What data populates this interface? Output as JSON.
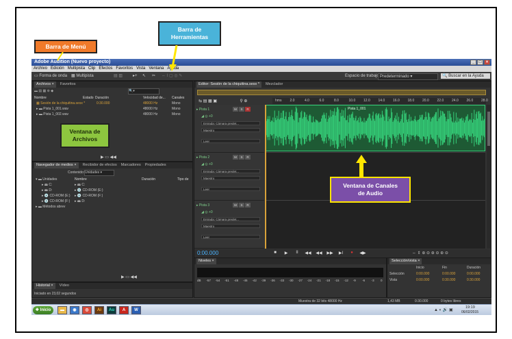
{
  "window": {
    "title": "Adobe Audition (Nuevo proyecto)"
  },
  "menubar": {
    "items": [
      "Archivo",
      "Edición",
      "Multipista",
      "Clip",
      "Efectos",
      "Favoritos",
      "Vista",
      "Ventana",
      "Ayuda"
    ]
  },
  "toolbar": {
    "mode_waveform": "Forma de onda",
    "mode_multitrack": "Multipista",
    "workspace_label": "Espacio de trabajo:",
    "workspace_value": "Predeterminado",
    "help_search": "Buscar en la Ayuda"
  },
  "files_panel": {
    "tabs": [
      "Archivos ×",
      "Favoritos"
    ],
    "columns": [
      "Nombre",
      "Estado",
      "Duración",
      "Velocidad de...",
      "Canales"
    ],
    "rows": [
      {
        "name": "Sesión de la chiquitina.sesx *",
        "duration": "0:30.000",
        "rate": "48000 Hz",
        "channels": "Mono"
      },
      {
        "name": "Pista 1_001.wav",
        "duration": "",
        "rate": "48000 Hz",
        "channels": "Mono"
      },
      {
        "name": "Pista 1_002.wav",
        "duration": "",
        "rate": "48000 Hz",
        "channels": "Mono"
      }
    ]
  },
  "media_panel": {
    "tabs": [
      "Navegador de medios ×",
      "Recibidor de efectos",
      "Marcadores",
      "Propiedades"
    ],
    "content_label": "Contenido:",
    "content_value": "Unidades",
    "left_header": "Unidades",
    "right_columns": [
      "Nombre",
      "Duración",
      "Tipo de"
    ],
    "drives": [
      "C:",
      "D:",
      "CD-ROM (E:)",
      "CD-ROM (F:)"
    ],
    "favorites": "Métodos abrev",
    "right_items": [
      "C:",
      "CD-ROM (E:)",
      "CD-ROM (F:)",
      "D:"
    ]
  },
  "history_panel": {
    "tabs": [
      "Historial ×",
      "Vídeo"
    ],
    "status": "Iniciado en 23,02 segundos"
  },
  "editor": {
    "tabs": [
      "Editor: Sesión de la chiquitina.sesx *",
      "Mezclador"
    ],
    "ruler": [
      "hms",
      "2.0",
      "4.0",
      "6.0",
      "8.0",
      "10.0",
      "12.0",
      "14.0",
      "16.0",
      "18.0",
      "20.0",
      "22.0",
      "24.0",
      "26.0",
      "28.0"
    ],
    "timecode": "0:00.000",
    "tracks": [
      {
        "name": "Pista 1",
        "input": "Entrada: Cámara predet...",
        "output": "Maestro",
        "mode": "Leer",
        "volume": "+0"
      },
      {
        "name": "Pista 2",
        "input": "Entrada: Cámara predet...",
        "output": "Maestro",
        "mode": "Leer",
        "volume": "+0"
      },
      {
        "name": "Pista 3",
        "input": "Entrada: Cámara predet...",
        "output": "Maestro",
        "mode": "Leer",
        "volume": "+0"
      }
    ],
    "clip_label": "Pista 1_001",
    "transport": [
      "■",
      "▶",
      "II",
      "◀◀",
      "◀◀",
      "▶▶",
      "▶I",
      "●",
      "◀▶"
    ]
  },
  "levels_panel": {
    "tab": "Niveles ×",
    "scale": [
      "dB",
      "-57",
      "-54",
      "-51",
      "-48",
      "-45",
      "-42",
      "-39",
      "-36",
      "-33",
      "-30",
      "-27",
      "-24",
      "-21",
      "-18",
      "-15",
      "-12",
      "-9",
      "-6",
      "-3",
      "0"
    ]
  },
  "selection_panel": {
    "tab": "Selección/vista ×",
    "headers": [
      "Inicio",
      "Fin",
      "Duración"
    ],
    "rows": [
      {
        "label": "Selección",
        "start": "0:00.000",
        "end": "0:00.000",
        "duration": "0:00.000"
      },
      {
        "label": "Vista",
        "start": "0:00.000",
        "end": "0:30.000",
        "duration": "0:30.000"
      }
    ]
  },
  "status": {
    "rate": "Muestra de 32 bits 48000 Hz",
    "size": "1,43 MB",
    "dur": "0:30.000",
    "free": "0 bytes libres"
  },
  "taskbar": {
    "start": "Inicio",
    "clock": "19:19",
    "date": "06/02/2015",
    "apps": [
      "Ai",
      "Au",
      "A"
    ]
  },
  "callouts": {
    "menu": "Barra de Menú",
    "toolbar": "Barra de\nHerramientas",
    "files": "Ventana de\nArchivos",
    "tracks": "Ventana de Canales\nde Audio"
  },
  "colors": {
    "menu_callout": "#f07a2a",
    "toolbar_callout": "#4ab3d9",
    "files_callout": "#8dc63f",
    "tracks_callout": "#7b4fa8",
    "arrow": "#ffe600",
    "waveform": "#35d07a"
  }
}
